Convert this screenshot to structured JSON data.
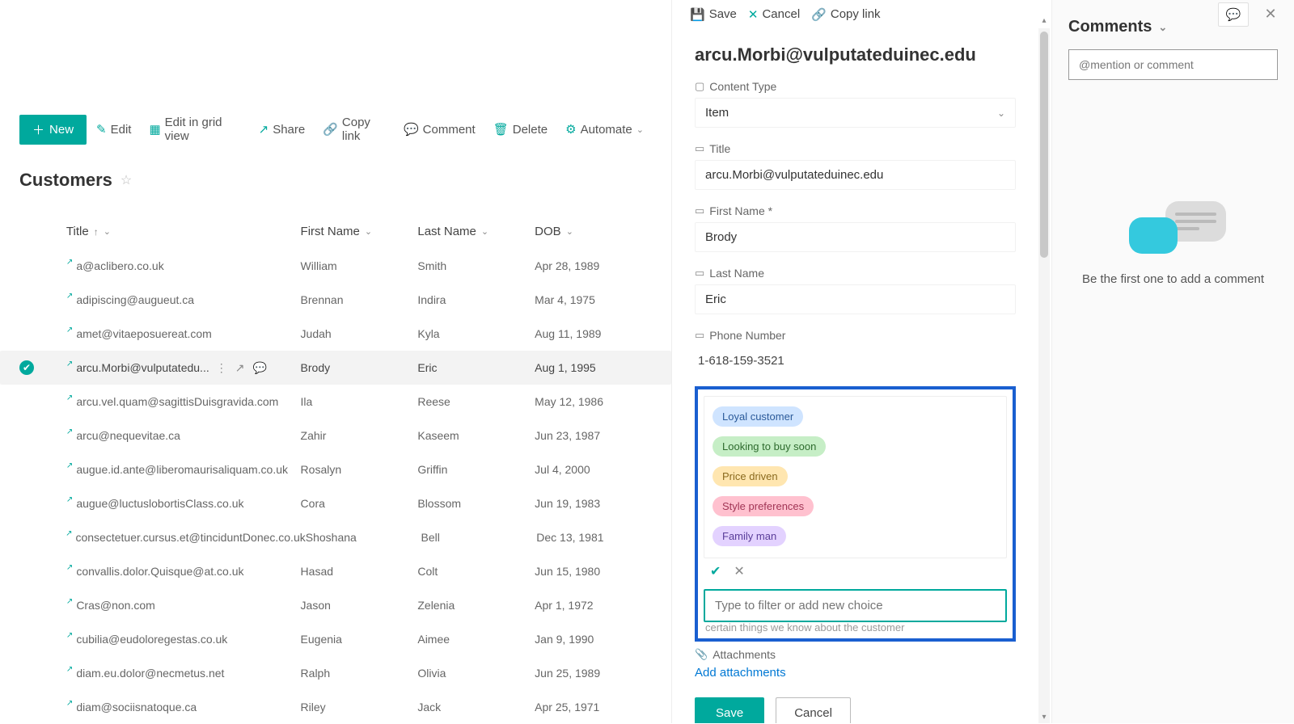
{
  "toolbar": {
    "new": "New",
    "edit": "Edit",
    "editGrid": "Edit in grid view",
    "share": "Share",
    "copyLink": "Copy link",
    "comment": "Comment",
    "delete": "Delete",
    "automate": "Automate"
  },
  "listTitle": "Customers",
  "columns": {
    "title": "Title",
    "firstName": "First Name",
    "lastName": "Last Name",
    "dob": "DOB"
  },
  "rows": [
    {
      "title": "a@aclibero.co.uk",
      "fn": "William",
      "ln": "Smith",
      "dob": "Apr 28, 1989"
    },
    {
      "title": "adipiscing@augueut.ca",
      "fn": "Brennan",
      "ln": "Indira",
      "dob": "Mar 4, 1975"
    },
    {
      "title": "amet@vitaeposuereat.com",
      "fn": "Judah",
      "ln": "Kyla",
      "dob": "Aug 11, 1989"
    },
    {
      "title": "arcu.Morbi@vulputatedu...",
      "fn": "Brody",
      "ln": "Eric",
      "dob": "Aug 1, 1995"
    },
    {
      "title": "arcu.vel.quam@sagittisDuisgravida.com",
      "fn": "Ila",
      "ln": "Reese",
      "dob": "May 12, 1986"
    },
    {
      "title": "arcu@nequevitae.ca",
      "fn": "Zahir",
      "ln": "Kaseem",
      "dob": "Jun 23, 1987"
    },
    {
      "title": "augue.id.ante@liberomaurisaliquam.co.uk",
      "fn": "Rosalyn",
      "ln": "Griffin",
      "dob": "Jul 4, 2000"
    },
    {
      "title": "augue@luctuslobortisClass.co.uk",
      "fn": "Cora",
      "ln": "Blossom",
      "dob": "Jun 19, 1983"
    },
    {
      "title": "consectetuer.cursus.et@tinciduntDonec.co.uk",
      "fn": "Shoshana",
      "ln": "Bell",
      "dob": "Dec 13, 1981"
    },
    {
      "title": "convallis.dolor.Quisque@at.co.uk",
      "fn": "Hasad",
      "ln": "Colt",
      "dob": "Jun 15, 1980"
    },
    {
      "title": "Cras@non.com",
      "fn": "Jason",
      "ln": "Zelenia",
      "dob": "Apr 1, 1972"
    },
    {
      "title": "cubilia@eudoloregestas.co.uk",
      "fn": "Eugenia",
      "ln": "Aimee",
      "dob": "Jan 9, 1990"
    },
    {
      "title": "diam.eu.dolor@necmetus.net",
      "fn": "Ralph",
      "ln": "Olivia",
      "dob": "Jun 25, 1989"
    },
    {
      "title": "diam@sociisnatoque.ca",
      "fn": "Riley",
      "ln": "Jack",
      "dob": "Apr 25, 1971"
    }
  ],
  "selectedIndex": 3,
  "panel": {
    "top": {
      "save": "Save",
      "cancel": "Cancel",
      "copyLink": "Copy link"
    },
    "itemTitle": "arcu.Morbi@vulputateduinec.edu",
    "labels": {
      "contentType": "Content Type",
      "title": "Title",
      "firstName": "First Name *",
      "lastName": "Last Name",
      "phone": "Phone Number",
      "attachments": "Attachments"
    },
    "values": {
      "contentType": "Item",
      "title": "arcu.Morbi@vulputateduinec.edu",
      "firstName": "Brody",
      "lastName": "Eric",
      "phone": "1-618-159-3521"
    },
    "choices": [
      {
        "label": "Loyal customer",
        "cls": "pill-blue"
      },
      {
        "label": "Looking to buy soon",
        "cls": "pill-green"
      },
      {
        "label": "Price driven",
        "cls": "pill-yellow"
      },
      {
        "label": "Style preferences",
        "cls": "pill-pink"
      },
      {
        "label": "Family man",
        "cls": "pill-purple"
      }
    ],
    "choicePlaceholder": "Type to filter or add new choice",
    "underHint": "certain things we know about the customer",
    "addAttachments": "Add attachments",
    "saveBtn": "Save",
    "cancelBtn": "Cancel"
  },
  "comments": {
    "heading": "Comments",
    "placeholder": "@mention or comment",
    "empty": "Be the first one to add a comment"
  }
}
